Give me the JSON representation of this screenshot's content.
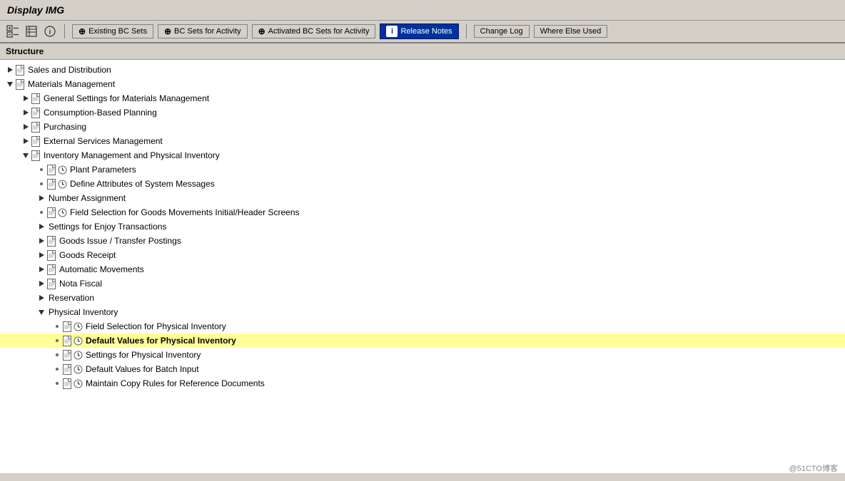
{
  "title": "Display IMG",
  "toolbar": {
    "icons": [
      {
        "name": "tree-icon",
        "symbol": "🌳"
      },
      {
        "name": "grid-icon",
        "symbol": "▦"
      },
      {
        "name": "info-icon",
        "symbol": "ℹ"
      }
    ],
    "buttons": [
      {
        "id": "existing-bc-sets",
        "label": "Existing BC Sets",
        "icon": "⊕",
        "active": false
      },
      {
        "id": "bc-sets-activity",
        "label": "BC Sets for Activity",
        "icon": "⊕",
        "active": false
      },
      {
        "id": "activated-bc-sets",
        "label": "Activated BC Sets for Activity",
        "icon": "⊕",
        "active": false
      },
      {
        "id": "release-notes",
        "label": "Release Notes",
        "icon": "i",
        "active": true
      },
      {
        "id": "change-log",
        "label": "Change Log",
        "active": false
      },
      {
        "id": "where-else-used",
        "label": "Where Else Used",
        "active": false
      }
    ]
  },
  "structure_label": "Structure",
  "tree": [
    {
      "id": "sales-dist",
      "label": "Sales and Distribution",
      "level": 0,
      "expand": "►",
      "has_doc": true,
      "bold": false
    },
    {
      "id": "mat-mgmt",
      "label": "Materials Management",
      "level": 0,
      "expand": "▼",
      "has_doc": true,
      "bold": false
    },
    {
      "id": "gen-settings",
      "label": "General Settings for Materials Management",
      "level": 1,
      "expand": "►",
      "has_doc": true,
      "bold": false
    },
    {
      "id": "consumption",
      "label": "Consumption-Based Planning",
      "level": 1,
      "expand": "►",
      "has_doc": true,
      "bold": false
    },
    {
      "id": "purchasing",
      "label": "Purchasing",
      "level": 1,
      "expand": "►",
      "has_doc": true,
      "bold": false
    },
    {
      "id": "ext-services",
      "label": "External Services Management",
      "level": 1,
      "expand": "►",
      "has_doc": true,
      "bold": false
    },
    {
      "id": "inv-mgmt",
      "label": "Inventory Management and Physical Inventory",
      "level": 1,
      "expand": "▼",
      "has_doc": true,
      "bold": false
    },
    {
      "id": "plant-params",
      "label": "Plant Parameters",
      "level": 2,
      "expand": "·",
      "has_doc": true,
      "has_clock": true,
      "bold": false
    },
    {
      "id": "define-attrs",
      "label": "Define Attributes of System Messages",
      "level": 2,
      "expand": "·",
      "has_doc": true,
      "has_clock": true,
      "bold": false
    },
    {
      "id": "number-assign",
      "label": "Number Assignment",
      "level": 2,
      "expand": "►",
      "has_doc": false,
      "bold": false
    },
    {
      "id": "field-sel-goods",
      "label": "Field Selection for Goods Movements Initial/Header Screens",
      "level": 2,
      "expand": "·",
      "has_doc": true,
      "has_clock": true,
      "bold": false
    },
    {
      "id": "settings-enjoy",
      "label": "Settings for Enjoy Transactions",
      "level": 2,
      "expand": "►",
      "has_doc": false,
      "bold": false
    },
    {
      "id": "goods-issue",
      "label": "Goods Issue / Transfer Postings",
      "level": 2,
      "expand": "►",
      "has_doc": true,
      "bold": false
    },
    {
      "id": "goods-receipt",
      "label": "Goods Receipt",
      "level": 2,
      "expand": "►",
      "has_doc": true,
      "bold": false
    },
    {
      "id": "auto-movements",
      "label": "Automatic Movements",
      "level": 2,
      "expand": "►",
      "has_doc": true,
      "bold": false
    },
    {
      "id": "nota-fiscal",
      "label": "Nota Fiscal",
      "level": 2,
      "expand": "►",
      "has_doc": true,
      "bold": false
    },
    {
      "id": "reservation",
      "label": "Reservation",
      "level": 2,
      "expand": "►",
      "has_doc": false,
      "bold": false
    },
    {
      "id": "physical-inv",
      "label": "Physical Inventory",
      "level": 2,
      "expand": "▼",
      "has_doc": false,
      "bold": false
    },
    {
      "id": "field-sel-phys",
      "label": "Field Selection for Physical Inventory",
      "level": 3,
      "expand": "·",
      "has_doc": true,
      "has_clock": true,
      "bold": false
    },
    {
      "id": "default-vals-phys",
      "label": "Default Values for Physical Inventory",
      "level": 3,
      "expand": "·",
      "has_doc": true,
      "has_clock": true,
      "bold": true,
      "highlighted": true
    },
    {
      "id": "settings-phys",
      "label": "Settings for Physical Inventory",
      "level": 3,
      "expand": "·",
      "has_doc": true,
      "has_clock": true,
      "bold": false
    },
    {
      "id": "default-vals-batch",
      "label": "Default Values for Batch Input",
      "level": 3,
      "expand": "·",
      "has_doc": true,
      "has_clock": true,
      "bold": false
    },
    {
      "id": "maintain-copy",
      "label": "Maintain Copy Rules for Reference Documents",
      "level": 3,
      "expand": "·",
      "has_doc": true,
      "has_clock": true,
      "bold": false
    }
  ],
  "watermark": "@51CTO博客"
}
